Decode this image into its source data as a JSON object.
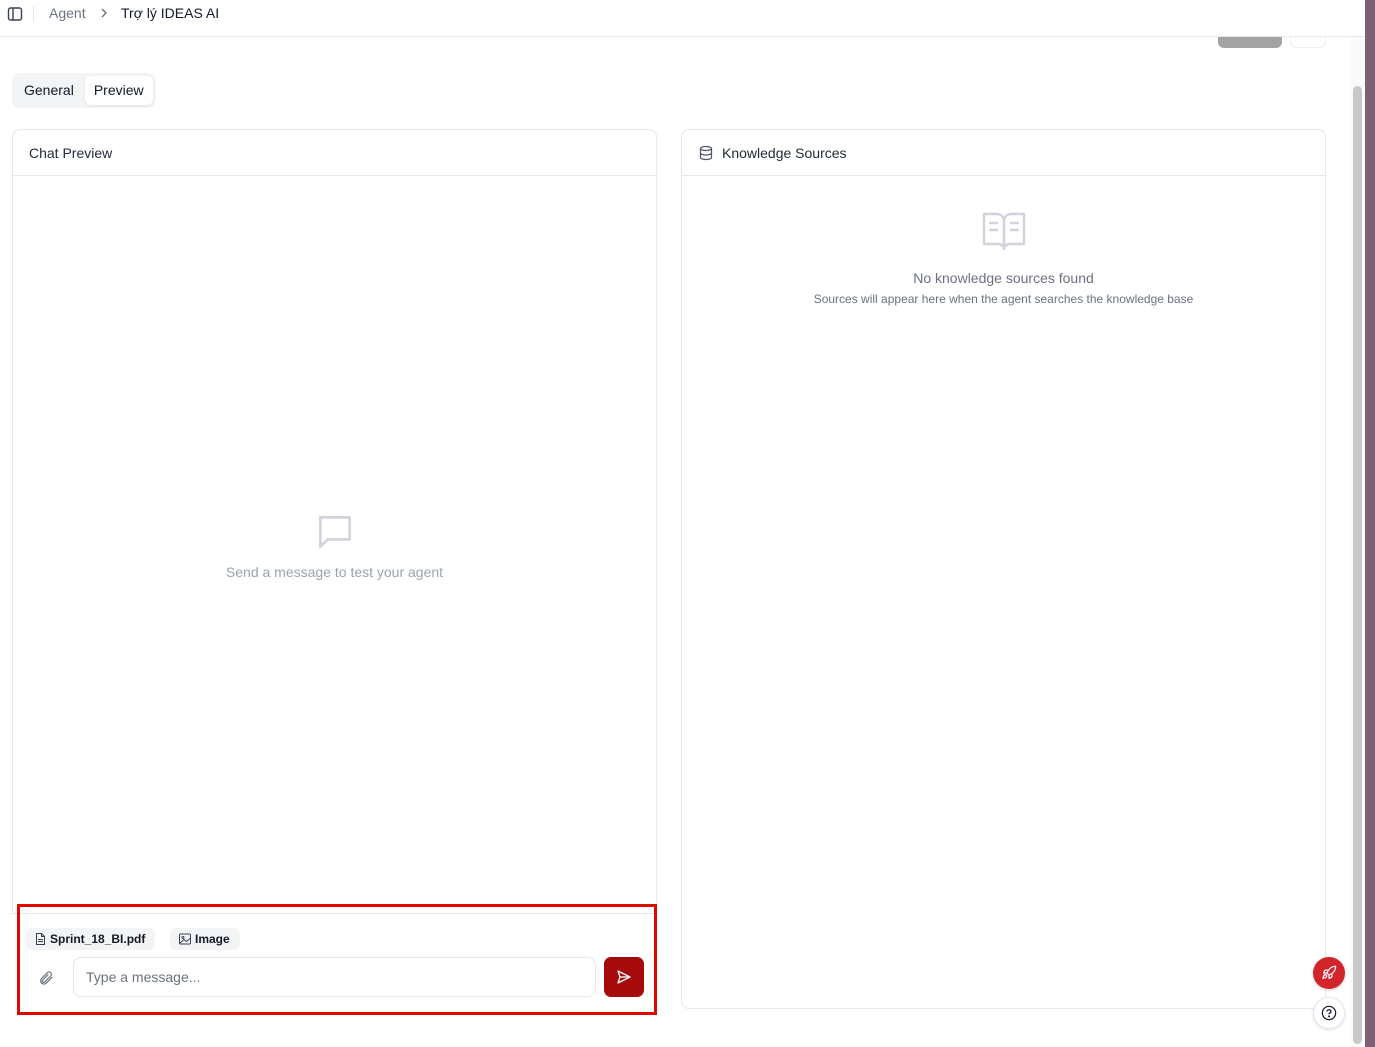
{
  "breadcrumb": {
    "parent": "Agent",
    "current": "Trợ lý IDEAS AI"
  },
  "tabs": [
    {
      "label": "General",
      "active": false
    },
    {
      "label": "Preview",
      "active": true
    }
  ],
  "chat_panel": {
    "title": "Chat Preview",
    "empty_text": "Send a message to test your agent"
  },
  "knowledge_panel": {
    "title": "Knowledge Sources",
    "empty_title": "No knowledge sources found",
    "empty_subtitle": "Sources will appear here when the agent searches the knowledge base"
  },
  "composer": {
    "attachments": [
      {
        "label": "Sprint_18_BI.pdf",
        "icon": "file-icon"
      },
      {
        "label": "Image",
        "icon": "image-icon"
      }
    ],
    "input_placeholder": "Type a message...",
    "input_value": ""
  },
  "colors": {
    "send_button": "#a70a0a",
    "highlight": "#e10600",
    "rocket_fab": "#d3232b"
  },
  "icons": {
    "sidebar": "sidebar-toggle-icon",
    "breadcrumb_separator": "chevron-right-icon",
    "knowledge": "database-icon",
    "book": "book-open-icon",
    "chat": "message-square-icon",
    "attach": "paperclip-icon",
    "send": "send-icon",
    "rocket": "rocket-icon",
    "help": "help-circle-icon"
  }
}
